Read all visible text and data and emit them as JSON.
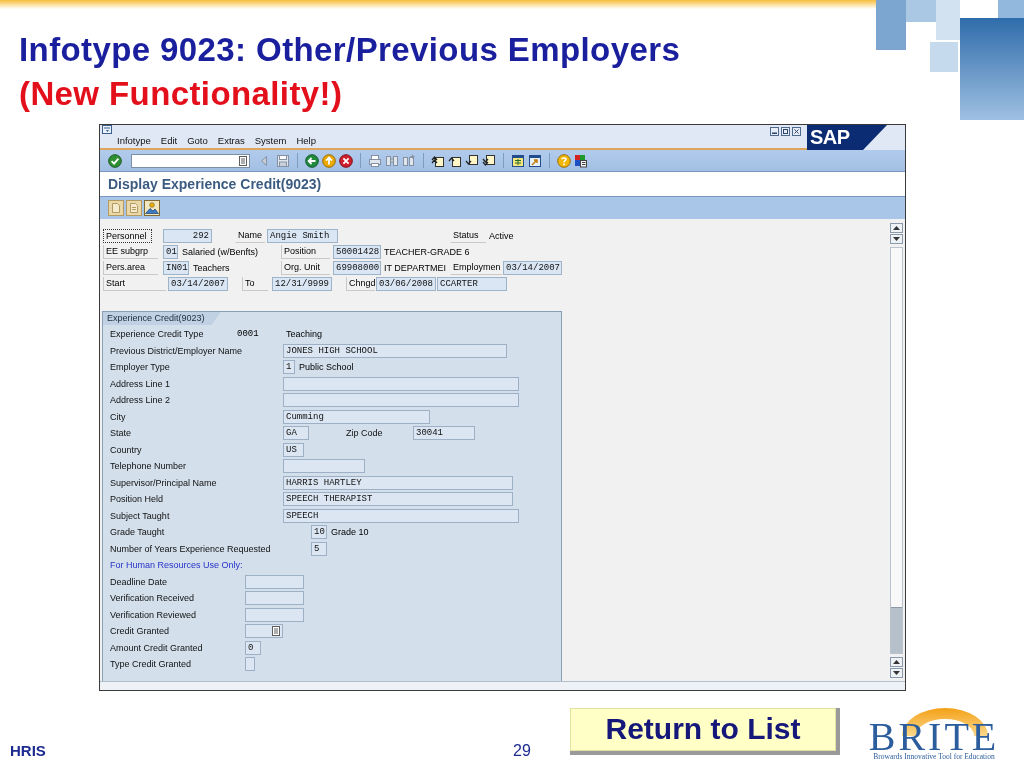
{
  "slide": {
    "title": "Infotype 9023: Other/Previous Employers",
    "subtitle": "(New Functionality!)"
  },
  "sap_window": {
    "menu": [
      "Infotype",
      "Edit",
      "Goto",
      "Extras",
      "System",
      "Help"
    ],
    "logo": "SAP",
    "screen_title": "Display Experience Credit(9023)",
    "header": {
      "personnel": {
        "label": "Personnel",
        "value": "292",
        "focused": true
      },
      "name": {
        "label": "Name",
        "value": "Angie Smith"
      },
      "status": {
        "label": "Status",
        "value": "Active"
      },
      "ee_subgroup": {
        "label": "EE subgrp",
        "code": "01",
        "text": "Salaried (w/Benfts)"
      },
      "position": {
        "label": "Position",
        "code": "50001428",
        "text": "TEACHER-GRADE 6"
      },
      "pers_area": {
        "label": "Pers.area",
        "code": "IN01",
        "text": "Teachers"
      },
      "org_unit": {
        "label": "Org. Unit",
        "code": "69908000",
        "text": "IT DEPARTMEI"
      },
      "employment": {
        "label": "Employmen",
        "value": "03/14/2007"
      },
      "start": {
        "label": "Start",
        "value": "03/14/2007"
      },
      "to": {
        "label": "To",
        "value": "12/31/9999"
      },
      "changed": {
        "label": "Chngd",
        "date": "03/06/2008",
        "user": "CCARTER"
      }
    },
    "group_box": {
      "title": "Experience Credit(9023)",
      "rows": [
        {
          "kind": "display",
          "label": "Experience Credit Type",
          "code": "0001",
          "text": "Teaching"
        },
        {
          "kind": "field",
          "label": "Previous District/Employer Name",
          "value": "JONES HIGH SCHOOL"
        },
        {
          "kind": "field-text",
          "label": "Employer Type",
          "value": "1",
          "text": "Public School"
        },
        {
          "kind": "field",
          "label": "Address Line 1"
        },
        {
          "kind": "field",
          "label": "Address Line 2"
        },
        {
          "kind": "field",
          "label": "City",
          "value": "Cumming"
        },
        {
          "kind": "field-pair",
          "label": "State",
          "value": "GA",
          "label2": "Zip Code",
          "value2": "30041"
        },
        {
          "kind": "field",
          "label": "Country",
          "value": "US"
        },
        {
          "kind": "field",
          "label": "Telephone Number"
        },
        {
          "kind": "field",
          "label": "Supervisor/Principal Name",
          "value": "HARRIS HARTLEY"
        },
        {
          "kind": "field",
          "label": "Position Held",
          "value": "SPEECH THERAPIST"
        },
        {
          "kind": "field",
          "label": "Subject Taught",
          "value": "SPEECH"
        },
        {
          "kind": "field-text",
          "label": "Grade Taught",
          "value": "10",
          "text": "Grade 10"
        },
        {
          "kind": "field",
          "label": "Number of Years Experience Requested",
          "value": "5"
        },
        {
          "kind": "note",
          "label": "For Human Resources Use Only:"
        },
        {
          "kind": "field",
          "label": "Deadline Date"
        },
        {
          "kind": "field",
          "label": "Verification Received"
        },
        {
          "kind": "field",
          "label": "Verification Reviewed"
        },
        {
          "kind": "dropdown",
          "label": "Credit Granted"
        },
        {
          "kind": "field",
          "label": "Amount Credit Granted",
          "value": "0"
        },
        {
          "kind": "field",
          "label": "Type Credit Granted"
        }
      ]
    }
  },
  "footer": {
    "left": "HRIS",
    "page_number": "29",
    "button": "Return to List",
    "logo": {
      "name": "BRITE",
      "tagline": "Browards Innovative Tool for Education"
    }
  }
}
